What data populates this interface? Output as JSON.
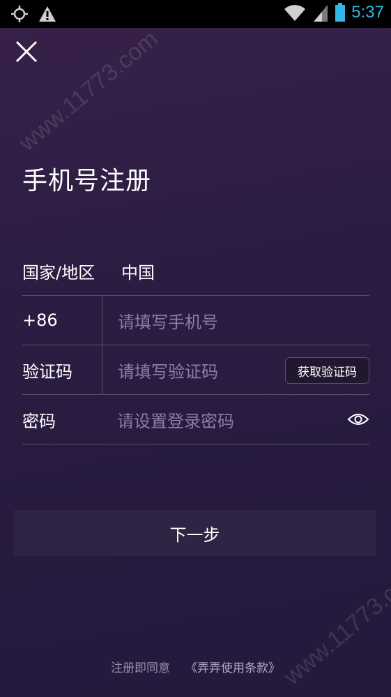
{
  "status_bar": {
    "time": "5:37",
    "icons": [
      "gps-icon",
      "warning-icon",
      "wifi-icon",
      "signal-icon",
      "battery-icon"
    ]
  },
  "header": {
    "title": "手机号注册"
  },
  "form": {
    "country": {
      "label": "国家/地区",
      "value": "中国"
    },
    "phone": {
      "code": "+86",
      "placeholder": "请填写手机号"
    },
    "verify": {
      "label": "验证码",
      "placeholder": "请填写验证码",
      "button": "获取验证码"
    },
    "password": {
      "label": "密码",
      "placeholder": "请设置登录密码"
    }
  },
  "next_button": {
    "label": "下一步"
  },
  "footer": {
    "text": "注册即同意",
    "terms_link": "《弄弄使用条款》"
  },
  "watermark": {
    "text": "www.11773.com"
  },
  "colors": {
    "background": "#2c1c42",
    "status_text": "#33b5e5",
    "placeholder": "#8c7da7",
    "divider": "#5a4d6c",
    "button_bg": "#2f2443"
  }
}
